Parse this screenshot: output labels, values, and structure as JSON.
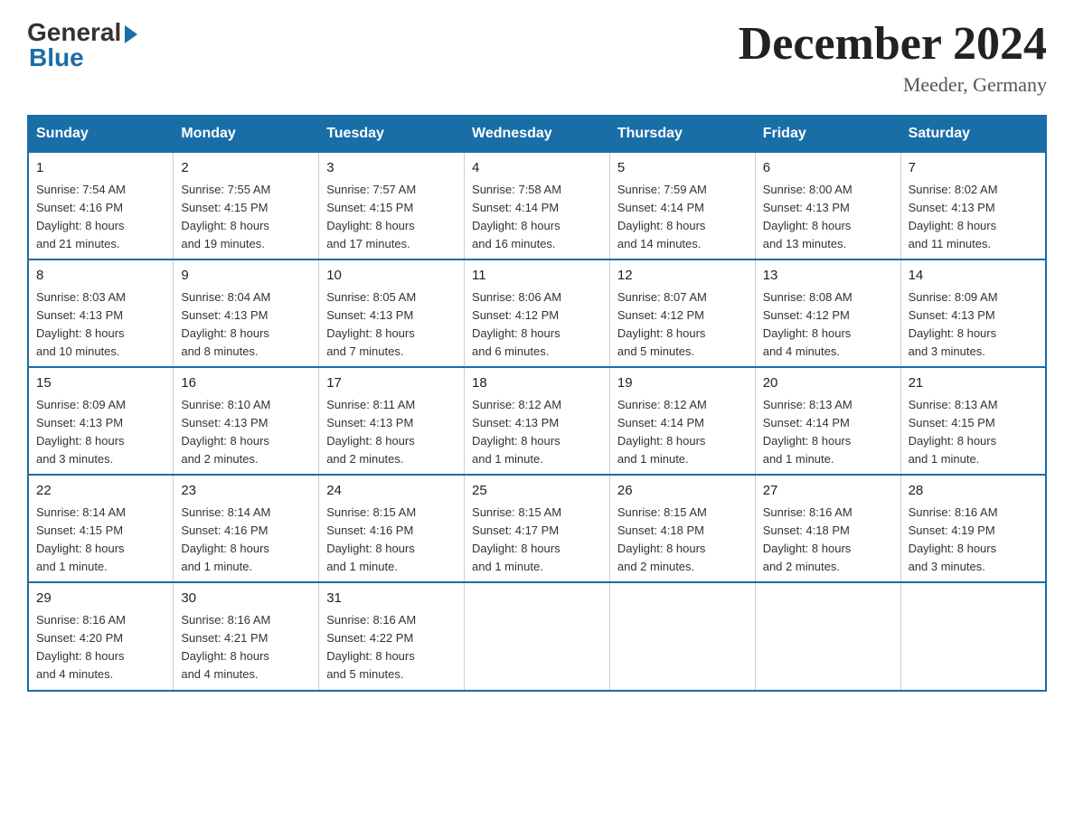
{
  "header": {
    "logo_general": "General",
    "logo_blue": "Blue",
    "month_title": "December 2024",
    "subtitle": "Meeder, Germany"
  },
  "weekdays": [
    "Sunday",
    "Monday",
    "Tuesday",
    "Wednesday",
    "Thursday",
    "Friday",
    "Saturday"
  ],
  "weeks": [
    [
      {
        "day": "1",
        "sunrise": "7:54 AM",
        "sunset": "4:16 PM",
        "daylight": "8 hours and 21 minutes."
      },
      {
        "day": "2",
        "sunrise": "7:55 AM",
        "sunset": "4:15 PM",
        "daylight": "8 hours and 19 minutes."
      },
      {
        "day": "3",
        "sunrise": "7:57 AM",
        "sunset": "4:15 PM",
        "daylight": "8 hours and 17 minutes."
      },
      {
        "day": "4",
        "sunrise": "7:58 AM",
        "sunset": "4:14 PM",
        "daylight": "8 hours and 16 minutes."
      },
      {
        "day": "5",
        "sunrise": "7:59 AM",
        "sunset": "4:14 PM",
        "daylight": "8 hours and 14 minutes."
      },
      {
        "day": "6",
        "sunrise": "8:00 AM",
        "sunset": "4:13 PM",
        "daylight": "8 hours and 13 minutes."
      },
      {
        "day": "7",
        "sunrise": "8:02 AM",
        "sunset": "4:13 PM",
        "daylight": "8 hours and 11 minutes."
      }
    ],
    [
      {
        "day": "8",
        "sunrise": "8:03 AM",
        "sunset": "4:13 PM",
        "daylight": "8 hours and 10 minutes."
      },
      {
        "day": "9",
        "sunrise": "8:04 AM",
        "sunset": "4:13 PM",
        "daylight": "8 hours and 8 minutes."
      },
      {
        "day": "10",
        "sunrise": "8:05 AM",
        "sunset": "4:13 PM",
        "daylight": "8 hours and 7 minutes."
      },
      {
        "day": "11",
        "sunrise": "8:06 AM",
        "sunset": "4:12 PM",
        "daylight": "8 hours and 6 minutes."
      },
      {
        "day": "12",
        "sunrise": "8:07 AM",
        "sunset": "4:12 PM",
        "daylight": "8 hours and 5 minutes."
      },
      {
        "day": "13",
        "sunrise": "8:08 AM",
        "sunset": "4:12 PM",
        "daylight": "8 hours and 4 minutes."
      },
      {
        "day": "14",
        "sunrise": "8:09 AM",
        "sunset": "4:13 PM",
        "daylight": "8 hours and 3 minutes."
      }
    ],
    [
      {
        "day": "15",
        "sunrise": "8:09 AM",
        "sunset": "4:13 PM",
        "daylight": "8 hours and 3 minutes."
      },
      {
        "day": "16",
        "sunrise": "8:10 AM",
        "sunset": "4:13 PM",
        "daylight": "8 hours and 2 minutes."
      },
      {
        "day": "17",
        "sunrise": "8:11 AM",
        "sunset": "4:13 PM",
        "daylight": "8 hours and 2 minutes."
      },
      {
        "day": "18",
        "sunrise": "8:12 AM",
        "sunset": "4:13 PM",
        "daylight": "8 hours and 1 minute."
      },
      {
        "day": "19",
        "sunrise": "8:12 AM",
        "sunset": "4:14 PM",
        "daylight": "8 hours and 1 minute."
      },
      {
        "day": "20",
        "sunrise": "8:13 AM",
        "sunset": "4:14 PM",
        "daylight": "8 hours and 1 minute."
      },
      {
        "day": "21",
        "sunrise": "8:13 AM",
        "sunset": "4:15 PM",
        "daylight": "8 hours and 1 minute."
      }
    ],
    [
      {
        "day": "22",
        "sunrise": "8:14 AM",
        "sunset": "4:15 PM",
        "daylight": "8 hours and 1 minute."
      },
      {
        "day": "23",
        "sunrise": "8:14 AM",
        "sunset": "4:16 PM",
        "daylight": "8 hours and 1 minute."
      },
      {
        "day": "24",
        "sunrise": "8:15 AM",
        "sunset": "4:16 PM",
        "daylight": "8 hours and 1 minute."
      },
      {
        "day": "25",
        "sunrise": "8:15 AM",
        "sunset": "4:17 PM",
        "daylight": "8 hours and 1 minute."
      },
      {
        "day": "26",
        "sunrise": "8:15 AM",
        "sunset": "4:18 PM",
        "daylight": "8 hours and 2 minutes."
      },
      {
        "day": "27",
        "sunrise": "8:16 AM",
        "sunset": "4:18 PM",
        "daylight": "8 hours and 2 minutes."
      },
      {
        "day": "28",
        "sunrise": "8:16 AM",
        "sunset": "4:19 PM",
        "daylight": "8 hours and 3 minutes."
      }
    ],
    [
      {
        "day": "29",
        "sunrise": "8:16 AM",
        "sunset": "4:20 PM",
        "daylight": "8 hours and 4 minutes."
      },
      {
        "day": "30",
        "sunrise": "8:16 AM",
        "sunset": "4:21 PM",
        "daylight": "8 hours and 4 minutes."
      },
      {
        "day": "31",
        "sunrise": "8:16 AM",
        "sunset": "4:22 PM",
        "daylight": "8 hours and 5 minutes."
      },
      null,
      null,
      null,
      null
    ]
  ],
  "labels": {
    "sunrise": "Sunrise:",
    "sunset": "Sunset:",
    "daylight": "Daylight:"
  }
}
